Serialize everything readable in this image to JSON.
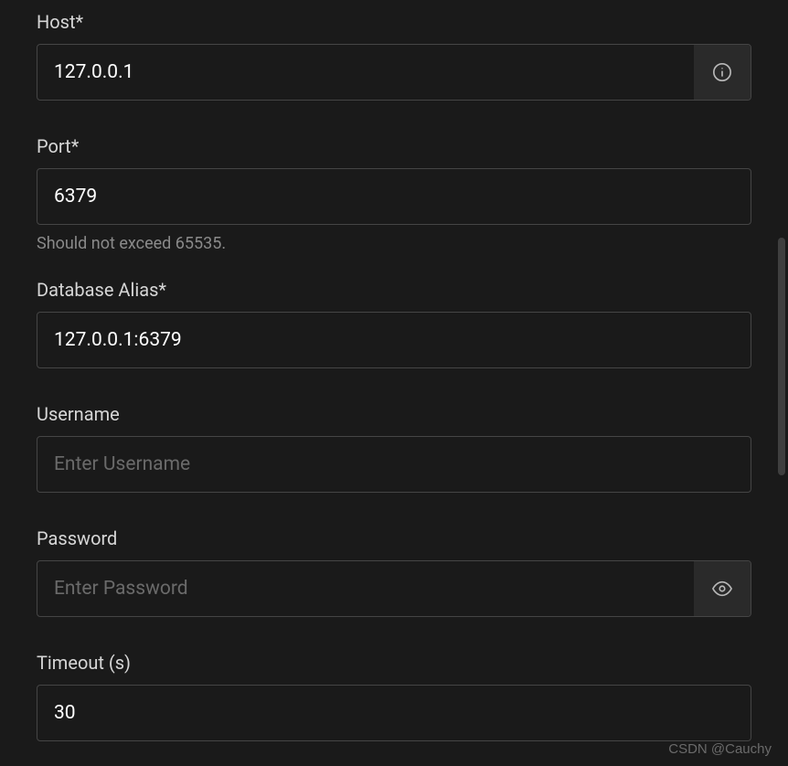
{
  "fields": {
    "host": {
      "label": "Host*",
      "value": "127.0.0.1",
      "placeholder": ""
    },
    "port": {
      "label": "Port*",
      "value": "6379",
      "placeholder": "",
      "hint": "Should not exceed 65535."
    },
    "alias": {
      "label": "Database Alias*",
      "value": "127.0.0.1:6379",
      "placeholder": ""
    },
    "username": {
      "label": "Username",
      "value": "",
      "placeholder": "Enter Username"
    },
    "password": {
      "label": "Password",
      "value": "",
      "placeholder": "Enter Password"
    },
    "timeout": {
      "label": "Timeout (s)",
      "value": "30",
      "placeholder": ""
    }
  },
  "watermark": "CSDN @Cauchy"
}
